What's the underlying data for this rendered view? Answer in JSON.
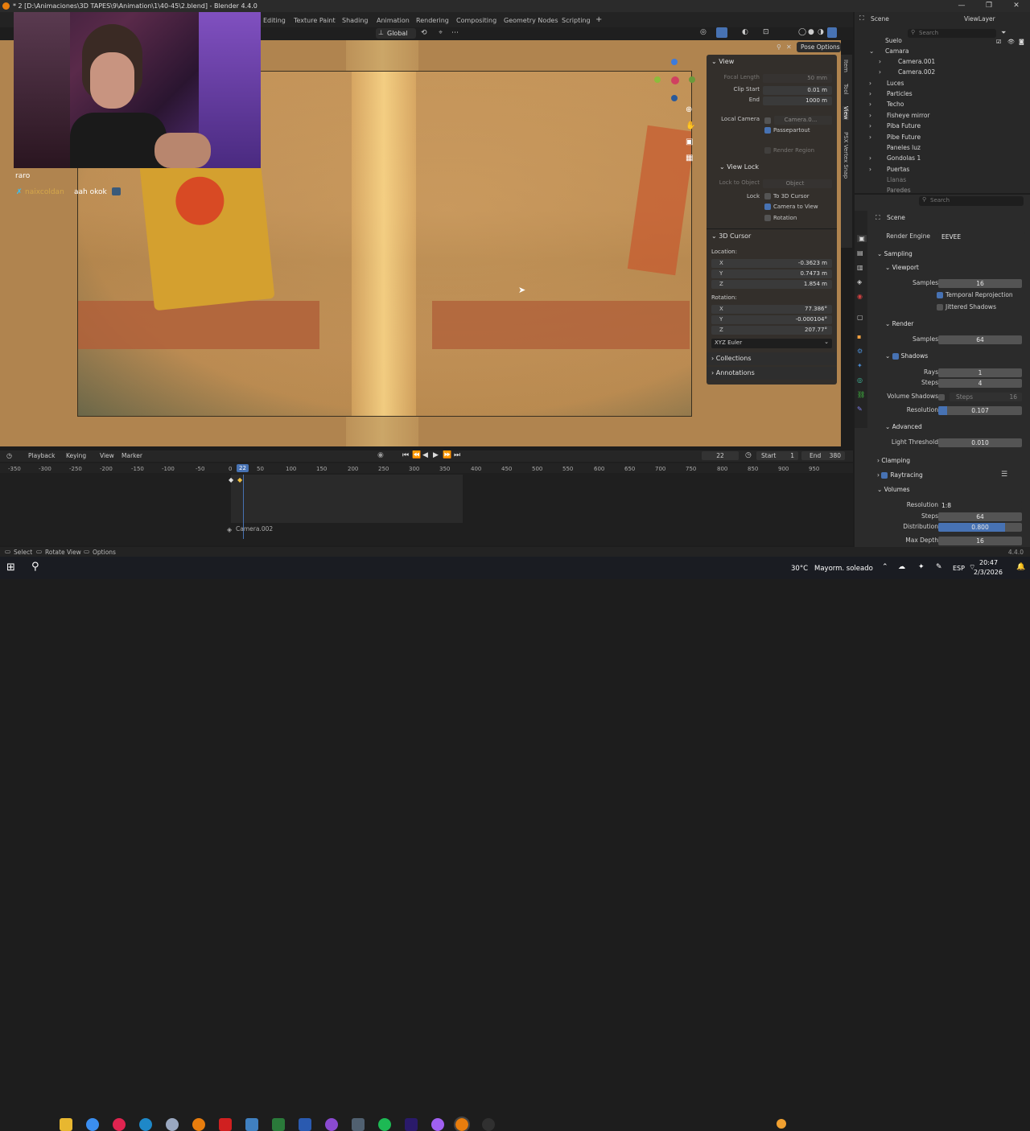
{
  "window": {
    "title": "* 2 [D:\\Animaciones\\3D TAPES\\9\\Animation\\1\\40-45\\2.blend] - Blender 4.4.0",
    "controls": [
      "—",
      "❐",
      "✕"
    ]
  },
  "workspaces": [
    "Editing",
    "Texture Paint",
    "Shading",
    "Animation",
    "Rendering",
    "Compositing",
    "Geometry Nodes",
    "Scripting",
    "+"
  ],
  "header": {
    "orientation": "Global",
    "pose_options": "Pose Options"
  },
  "npanel": {
    "view_title": "View",
    "focal_length_label": "Focal Length",
    "focal_length": "50 mm",
    "clip_start_label": "Clip Start",
    "clip_start": "0.01 m",
    "end_label": "End",
    "end": "1000 m",
    "local_camera_label": "Local Camera",
    "local_camera": "Camera.0...",
    "passepartout": "Passepartout",
    "render_region": "Render Region",
    "view_lock_title": "View Lock",
    "lock_to_object_label": "Lock to Object",
    "lock_to_object": "Object",
    "lock_label": "Lock",
    "to_3d_cursor": "To 3D Cursor",
    "camera_to_view": "Camera to View",
    "rotation_lock": "Rotation",
    "cursor_title": "3D Cursor",
    "location_label": "Location:",
    "loc_x": "-0.3623 m",
    "loc_y": "0.7473 m",
    "loc_z": "1.854 m",
    "rotation_label": "Rotation:",
    "rot_x": "77.386°",
    "rot_y": "-0.000104°",
    "rot_z": "207.77°",
    "euler": "XYZ Euler",
    "collections": "Collections",
    "annotations": "Annotations",
    "axis_x": "X",
    "axis_y": "Y",
    "axis_z": "Z"
  },
  "side_tabs": [
    "Item",
    "Tool",
    "View",
    "PSX Vertex Snap"
  ],
  "chat": {
    "line1": "raro",
    "user": "naixcoldan",
    "message": "aah okok"
  },
  "timeline": {
    "menus": [
      "Playback",
      "Keying",
      "View",
      "Marker"
    ],
    "current_frame": "22",
    "start_label": "Start",
    "start": "1",
    "end_label": "End",
    "end": "380",
    "ticks": [
      "-350",
      "-300",
      "-250",
      "-200",
      "-150",
      "-100",
      "-50",
      "0",
      "22",
      "50",
      "100",
      "150",
      "200",
      "250",
      "300",
      "350",
      "400",
      "450",
      "500",
      "550",
      "600",
      "650",
      "700",
      "750",
      "800",
      "850",
      "900",
      "950"
    ],
    "track_label": "Camera.002"
  },
  "statusbar": {
    "select": "Select",
    "rotate": "Rotate View",
    "options": "Options",
    "version": "4.4.0"
  },
  "outliner": {
    "scene": "Scene",
    "view_layer": "ViewLayer",
    "search_placeholder": "Search",
    "rows": [
      "Suelo",
      "Camara",
      "Camera.001",
      "Camera.002",
      "Luces",
      "Particles",
      "Techo",
      "Fisheye mirror",
      "Piba Future",
      "Pibe Future",
      "Paneles luz",
      "Gondolas 1",
      "Puertas",
      "Llanas",
      "Paredes"
    ]
  },
  "properties": {
    "search_placeholder": "Search",
    "scene": "Scene",
    "render_engine_label": "Render Engine",
    "render_engine": "EEVEE",
    "sampling": "Sampling",
    "viewport": "Viewport",
    "samples_label": "Samples",
    "viewport_samples": "16",
    "temporal_reprojection": "Temporal Reprojection",
    "jittered_shadows": "Jittered Shadows",
    "render": "Render",
    "render_samples": "64",
    "shadows": "Shadows",
    "rays_label": "Rays",
    "rays": "1",
    "steps_label": "Steps",
    "steps": "4",
    "volume_shadows_label": "Volume Shadows",
    "volume_shadows_steps_label": "Steps",
    "volume_shadows_steps": "16",
    "resolution_label": "Resolution",
    "resolution": "0.107",
    "resolution_fill": 0.107,
    "advanced": "Advanced",
    "light_threshold_label": "Light Threshold",
    "light_threshold": "0.010",
    "clamping": "Clamping",
    "raytracing": "Raytracing",
    "volumes": "Volumes",
    "vol_resolution_label": "Resolution",
    "vol_resolution": "1:8",
    "vol_steps_label": "Steps",
    "vol_steps": "64",
    "distribution_label": "Distribution",
    "distribution": "0.800",
    "distribution_fill": 0.8,
    "max_depth_label": "Max Depth",
    "max_depth": "16"
  },
  "taskbar": {
    "weather_temp": "30°C",
    "weather_text": "Mayorm. soleado",
    "lang": "ESP",
    "time": "20:47",
    "date": "2/3/2026"
  },
  "colors": {
    "accent": "#4772b3",
    "bg": "#1d1d1d",
    "panel": "#2b2b2b",
    "viewport": "#b0844f"
  }
}
